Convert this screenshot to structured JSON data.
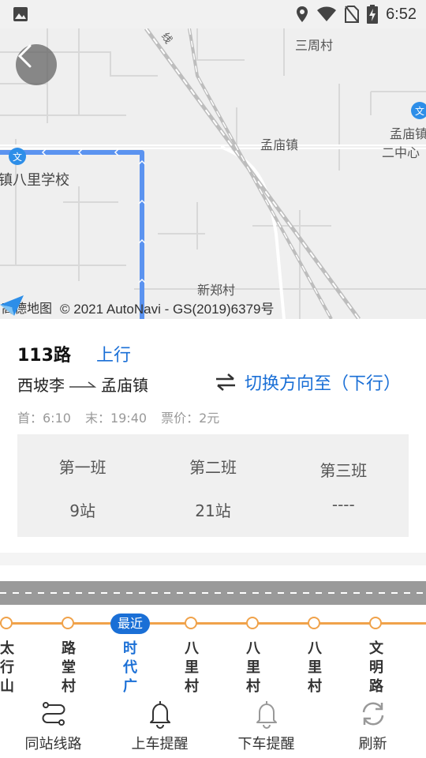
{
  "status_bar": {
    "time": "6:52"
  },
  "map": {
    "labels": {
      "sanzhoucun": "三周村",
      "mengmiaozhen": "孟庙镇",
      "mengmiao_school_1": "孟庙镇",
      "mengmiao_school_2": "二中心",
      "bali_school": "镇八里学校",
      "xinzhengcun": "新郑村",
      "rail": "线"
    },
    "provider": "高德地图",
    "copyright": "© 2021 AutoNavi - GS(2019)6379号"
  },
  "route": {
    "name": "113路",
    "direction": "上行",
    "from": "西坡李",
    "to": "孟庙镇",
    "switch_label": "切换方向至（下行）",
    "first_bus": "首：6:10",
    "last_bus": "末：19:40",
    "fare": "票价：2元"
  },
  "schedule": [
    {
      "name": "第一班",
      "stops": "9站"
    },
    {
      "name": "第二班",
      "stops": "21站"
    },
    {
      "name": "第三班",
      "stops": "----"
    }
  ],
  "stations": [
    {
      "name": "太行山路"
    },
    {
      "name": "路堂村"
    },
    {
      "name": "时代广场"
    },
    {
      "name": "八里村"
    },
    {
      "name": "八里村西"
    },
    {
      "name": "八里村东"
    },
    {
      "name": "文明路"
    }
  ],
  "nearest_badge": "最近",
  "nav": [
    {
      "label": "同站线路",
      "icon": "route-icon"
    },
    {
      "label": "上车提醒",
      "icon": "bell-icon"
    },
    {
      "label": "下车提醒",
      "icon": "bell-icon"
    },
    {
      "label": "刷新",
      "icon": "refresh-icon"
    }
  ],
  "colors": {
    "accent": "#1a6fd6",
    "route_line": "#5b93f0",
    "track": "#f0a24a"
  }
}
